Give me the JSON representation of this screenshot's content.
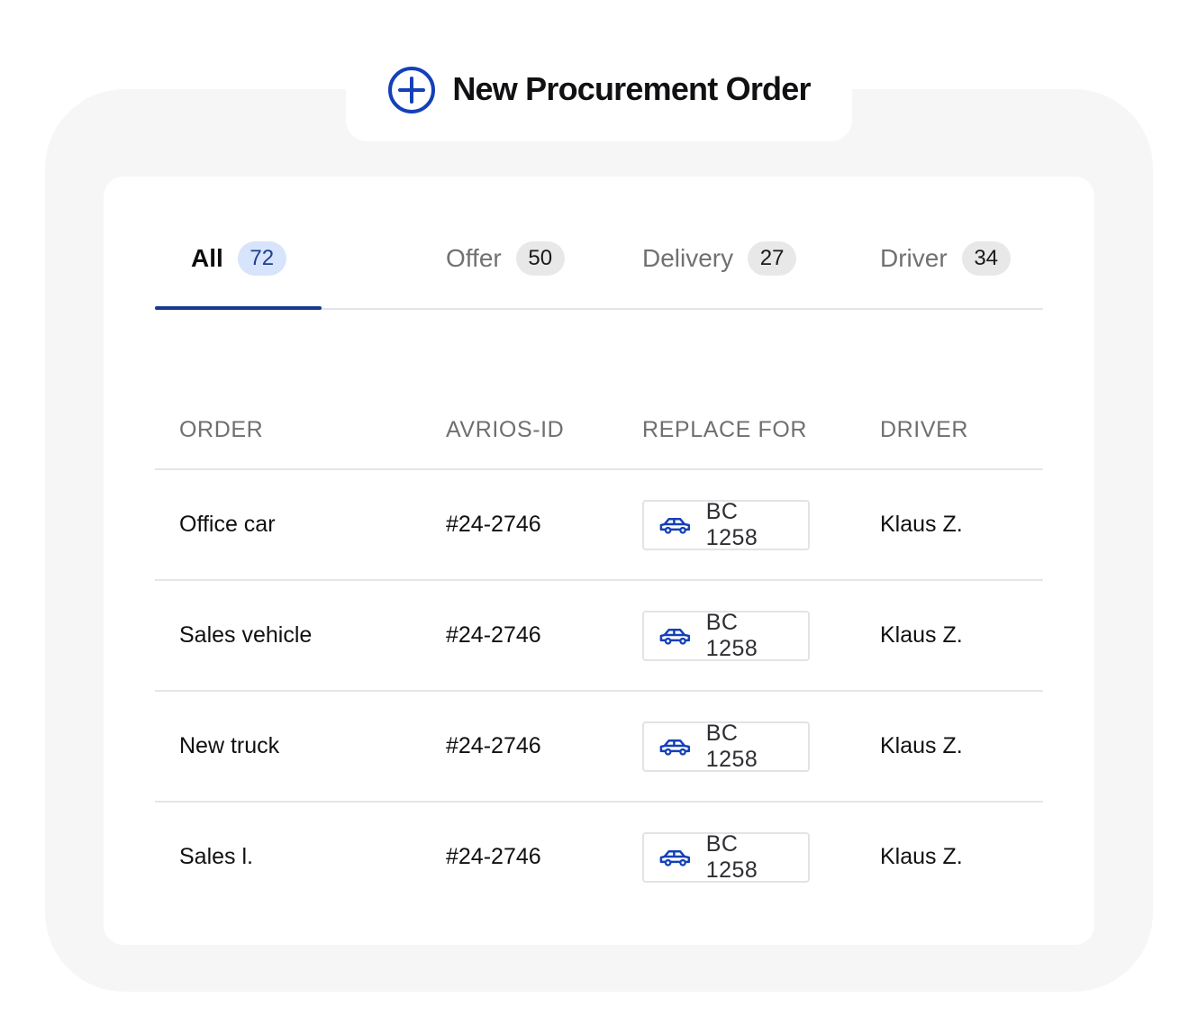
{
  "header": {
    "title": "New Procurement Order",
    "icon": "plus-circle-icon",
    "accent_color": "#1440b8"
  },
  "tabs": [
    {
      "label": "All",
      "count": "72",
      "active": true
    },
    {
      "label": "Offer",
      "count": "50",
      "active": false
    },
    {
      "label": "Delivery",
      "count": "27",
      "active": false
    },
    {
      "label": "Driver",
      "count": "34",
      "active": false
    }
  ],
  "table": {
    "columns": [
      "ORDER",
      "AVRIOS-ID",
      "REPLACE FOR",
      "DRIVER"
    ],
    "rows": [
      {
        "order": "Office car",
        "id": "#24-2746",
        "replace_for": "BC 1258",
        "driver": "Klaus Z."
      },
      {
        "order": "Sales vehicle",
        "id": "#24-2746",
        "replace_for": "BC 1258",
        "driver": "Klaus Z."
      },
      {
        "order": "New truck",
        "id": "#24-2746",
        "replace_for": "BC 1258",
        "driver": "Klaus Z."
      },
      {
        "order": "Sales l.",
        "id": "#24-2746",
        "replace_for": "BC 1258",
        "driver": "Klaus Z."
      }
    ]
  },
  "colors": {
    "active_tab_underline": "#173a8d",
    "active_badge_bg": "#d7e4fb",
    "car_icon": "#1440b8"
  }
}
